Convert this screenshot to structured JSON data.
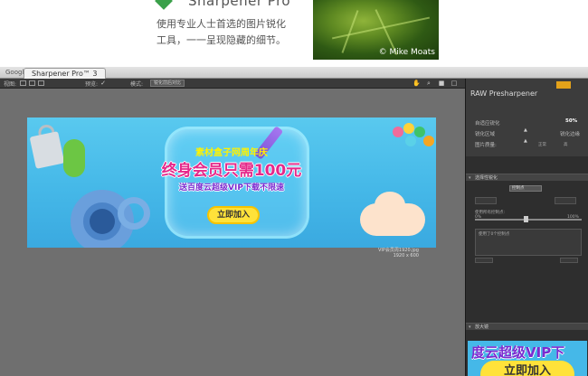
{
  "promo": {
    "product_name": "Sharpener Pro",
    "description_line1": "使用专业人士首选的图片锐化",
    "description_line2": "工具，一一呈现隐藏的细节。",
    "photo_credit": "© Mike Moats"
  },
  "window": {
    "tab_google": "Google",
    "tab_title": "Sharpener Pro™ 3",
    "toolbar": {
      "view_label": "视图:",
      "preview_label": "预览:",
      "mode_label": "模式:",
      "mode_value": "锐化前后对比"
    }
  },
  "banner": {
    "line1": "素材盒子网周年庆",
    "line2": "终身会员只需100元",
    "line3": "送百度云超级VIP下载不限速",
    "button": "立即加入",
    "caption_line1": "VIP会员周1920.jpg",
    "caption_line2": "1920 x 600"
  },
  "panel": {
    "title": "RAW Presharpener",
    "adaptive_label": "自适应锐化",
    "adaptive_value": "50%",
    "area_label": "锐化区域",
    "edge_label": "锐化边缘",
    "quality_label": "图片质量:",
    "quality_low": "正常",
    "quality_high": "高",
    "section1": "选择性锐化",
    "select_value": "控制点",
    "range_label": "使用所有控制点:",
    "range_min": "0%",
    "range_max": "100%",
    "list_text": "使用了0个控制点",
    "section2": "放大镜",
    "thumb_line1": "度云超级VIP下",
    "thumb_button": "立即加入"
  },
  "colors": {
    "accent_green": "#3aa04a",
    "banner_blue": "#45b8e8",
    "headline_pink": "#e5288a",
    "subline_purple": "#7a2bd0",
    "button_yellow": "#ffe23a",
    "panel_dark": "#2e2e2e"
  }
}
